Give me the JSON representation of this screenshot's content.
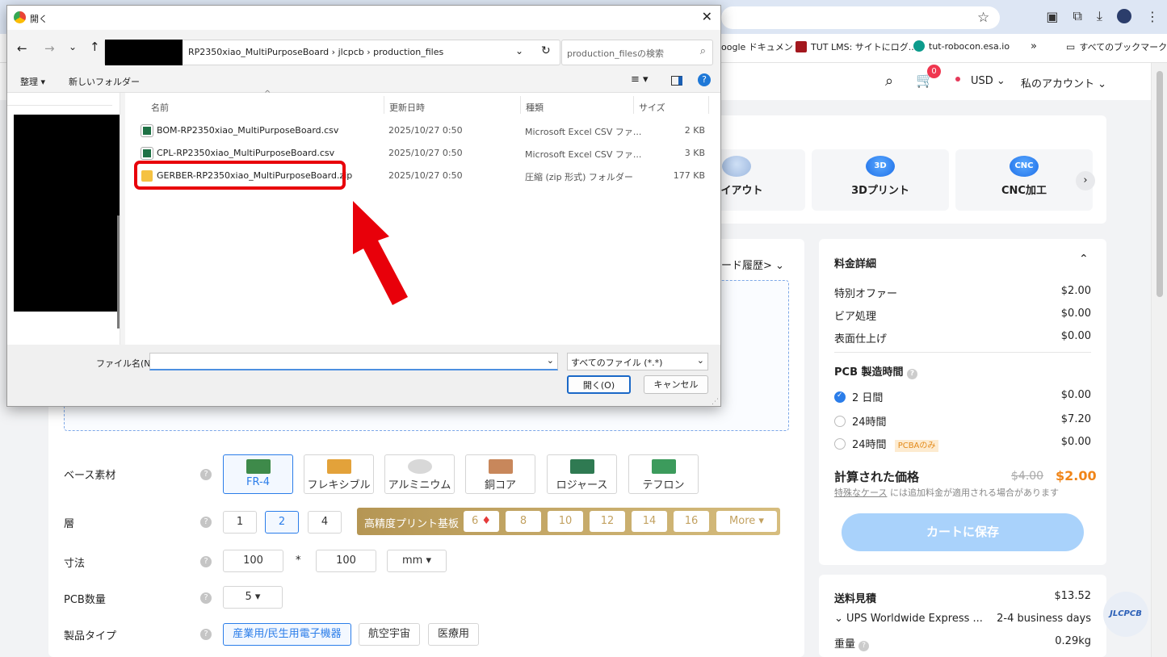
{
  "browser": {
    "bookmarks": [
      "oogle ドキュメント",
      "TUT LMS: サイトにログ...",
      "tut-robocon.esa.io",
      "すべてのブックマーク"
    ],
    "overflow": "»"
  },
  "site": {
    "cart_count": "0",
    "currency": "USD",
    "account": "私のアカウント"
  },
  "services": [
    {
      "label": "レイアウト"
    },
    {
      "label": "3Dプリント",
      "badge": "3D"
    },
    {
      "label": "CNC加工",
      "badge": "CNC"
    }
  ],
  "upload_history": "ード履歴>",
  "form": {
    "base_material": {
      "label": "ベース素材",
      "options": [
        "FR-4",
        "フレキシブル",
        "アルミニウム",
        "銅コア",
        "ロジャース",
        "テフロン"
      ]
    },
    "layers": {
      "label": "層",
      "options": [
        "1",
        "2",
        "4"
      ],
      "hp_label": "高精度プリント基板",
      "hp_options": [
        "6",
        "8",
        "10",
        "12",
        "14",
        "16"
      ],
      "more": "More"
    },
    "size": {
      "label": "寸法",
      "w": "100",
      "times": "*",
      "h": "100",
      "unit": "mm"
    },
    "qty": {
      "label": "PCB数量",
      "value": "5"
    },
    "product_type": {
      "label": "製品タイプ",
      "options": [
        "産業用/民生用電子機器",
        "航空宇宙",
        "医療用"
      ]
    }
  },
  "pricing": {
    "title": "料金詳細",
    "rows": [
      {
        "label": "特別オファー",
        "value": "$2.00"
      },
      {
        "label": "ビア処理",
        "value": "$0.00"
      },
      {
        "label": "表面仕上げ",
        "value": "$0.00"
      }
    ],
    "build_time_title": "PCB 製造時間",
    "build_times": [
      {
        "label": "2 日間",
        "value": "$0.00"
      },
      {
        "label": "24時間",
        "value": "$7.20"
      },
      {
        "label": "24時間",
        "tag": "PCBAのみ",
        "value": "$0.00"
      }
    ],
    "calc_label": "計算された価格",
    "old_price": "$4.00",
    "price": "$2.00",
    "note_link": "特殊なケース",
    "note_rest": " には追加料金が適用される場合があります",
    "save_button": "カートに保存"
  },
  "shipping": {
    "title": "送料見積",
    "value": "$13.52",
    "method": "UPS Worldwide Express ...",
    "days": "2-4 business days",
    "weight_label": "重量",
    "weight": "0.29kg"
  },
  "chat_badge": "JLCPCB",
  "dialog": {
    "title": "開く",
    "breadcrumb": [
      "RP2350xiao_MultiPurposeBoard",
      "jlcpcb",
      "production_files"
    ],
    "sep": "›",
    "search_placeholder": "production_filesの検索",
    "organize": "整理",
    "new_folder": "新しいフォルダー",
    "columns": [
      "名前",
      "更新日時",
      "種類",
      "サイズ"
    ],
    "files": [
      {
        "name": "BOM-RP2350xiao_MultiPurposeBoard.csv",
        "date": "2025/10/27 0:50",
        "type": "Microsoft Excel CSV ファ...",
        "size": "2 KB"
      },
      {
        "name": "CPL-RP2350xiao_MultiPurposeBoard.csv",
        "date": "2025/10/27 0:50",
        "type": "Microsoft Excel CSV ファ...",
        "size": "3 KB"
      },
      {
        "name": "GERBER-RP2350xiao_MultiPurposeBoard.zip",
        "date": "2025/10/27 0:50",
        "type": "圧縮 (zip 形式) フォルダー",
        "size": "177 KB"
      }
    ],
    "filename_label": "ファイル名(N):",
    "filename_value": "",
    "filter": "すべてのファイル (*.*)",
    "open": "開く(O)",
    "cancel": "キャンセル"
  }
}
